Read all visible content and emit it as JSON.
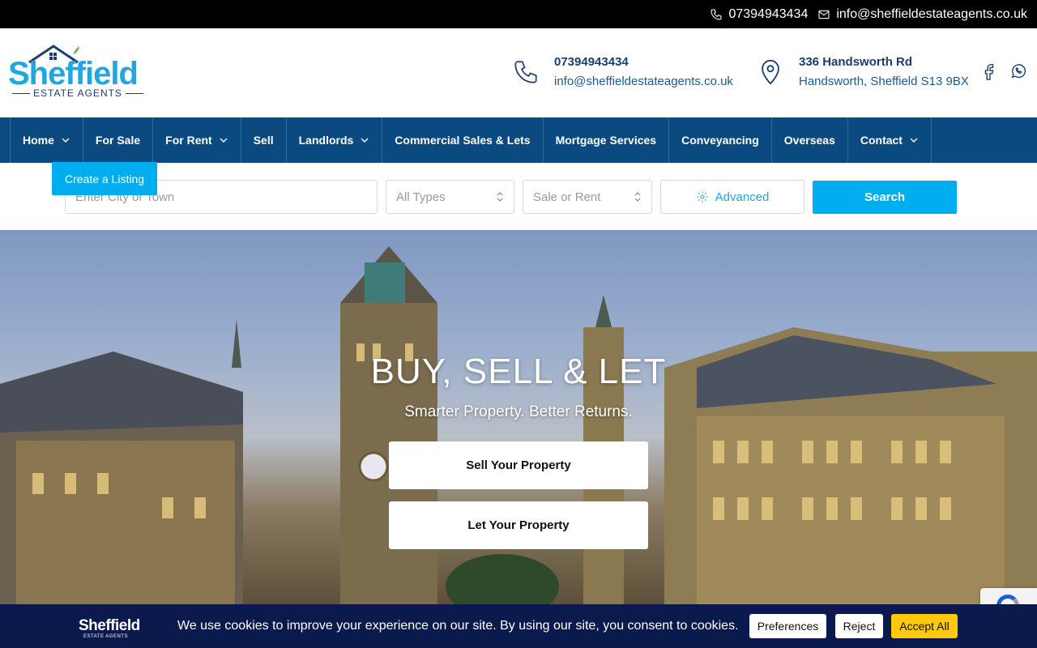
{
  "topbar": {
    "phone": "07394943434",
    "email": "info@sheffieldestateagents.co.uk"
  },
  "logo": {
    "name": "Sheffield",
    "tagline": "ESTATE AGENTS"
  },
  "header_contact": {
    "phone": "07394943434",
    "email": "info@sheffieldestateagents.co.uk",
    "address_line1": "336 Handsworth Rd",
    "address_line2": "Handsworth, Sheffield S13 9BX"
  },
  "social": [
    "facebook-icon",
    "whatsapp-icon"
  ],
  "nav": {
    "items": [
      {
        "label": "Home",
        "dropdown": true
      },
      {
        "label": "For Sale",
        "dropdown": false
      },
      {
        "label": "For Rent",
        "dropdown": true
      },
      {
        "label": "Sell",
        "dropdown": false
      },
      {
        "label": "Landlords",
        "dropdown": true
      },
      {
        "label": "Commercial Sales & Lets",
        "dropdown": false
      },
      {
        "label": "Mortgage Services",
        "dropdown": false
      },
      {
        "label": "Conveyancing",
        "dropdown": false
      },
      {
        "label": "Overseas",
        "dropdown": false
      },
      {
        "label": "Contact",
        "dropdown": true
      }
    ]
  },
  "create_listing": "Create a Listing",
  "search": {
    "city_placeholder": "Enter City or Town",
    "type_select": "All Types",
    "status_select": "Sale or Rent",
    "advanced": "Advanced",
    "button": "Search"
  },
  "hero": {
    "title": "BUY, SELL & LET",
    "subtitle": "Smarter Property. Better Returns.",
    "sell_button": "Sell Your Property",
    "let_button": "Let Your Property"
  },
  "cookie": {
    "logo_name": "Sheffield",
    "logo_tagline": "ESTATE AGENTS",
    "message": "We use cookies to improve your experience on our site. By using our site, you consent to cookies.",
    "preferences": "Preferences",
    "reject": "Reject",
    "accept": "Accept All"
  },
  "colors": {
    "brand_blue": "#1fa7e0",
    "nav_blue": "#0b4a80",
    "accent_cyan": "#00aeef",
    "cookie_bg": "#0b1a4d",
    "accept_yellow": "#ffc90e"
  }
}
